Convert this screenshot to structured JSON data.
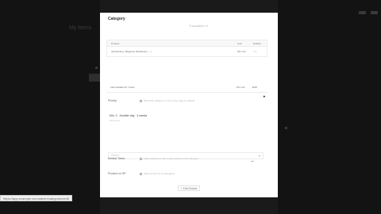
{
  "background": {
    "page_title": "My Items",
    "status_url": "https://app.example.com/admin/categories/edit"
  },
  "modal": {
    "title": "Category",
    "header_control": "Translation",
    "table1": {
      "headers": [
        "Product",
        "Unit",
        "Default"
      ],
      "rows": [
        {
          "name": "Introductory / Beginner Workbook (…)",
          "unit": "Per unit",
          "default": "Yes"
        }
      ]
    },
    "table2": {
      "rows": [
        {
          "name": "Intermediate Kit / Case",
          "unit": "Per unit",
          "default": "Both"
        }
      ]
    },
    "field1": {
      "label": "Priority",
      "checkbox_text": "Show this category on the home page by default"
    },
    "chip": {
      "a": "Min. 3",
      "b": "Another day",
      "c": "4 weeks"
    },
    "chip_sub": "Recurring",
    "select": {
      "placeholder": "Select"
    },
    "field2": {
      "label": "Default Taxes",
      "checkbox_text": "Apply default tax rate to all products in this category"
    },
    "field3": {
      "label": "Product on SP",
      "checkbox_text": "Allow product to be displayed"
    },
    "edit_button": "Edit Details"
  }
}
